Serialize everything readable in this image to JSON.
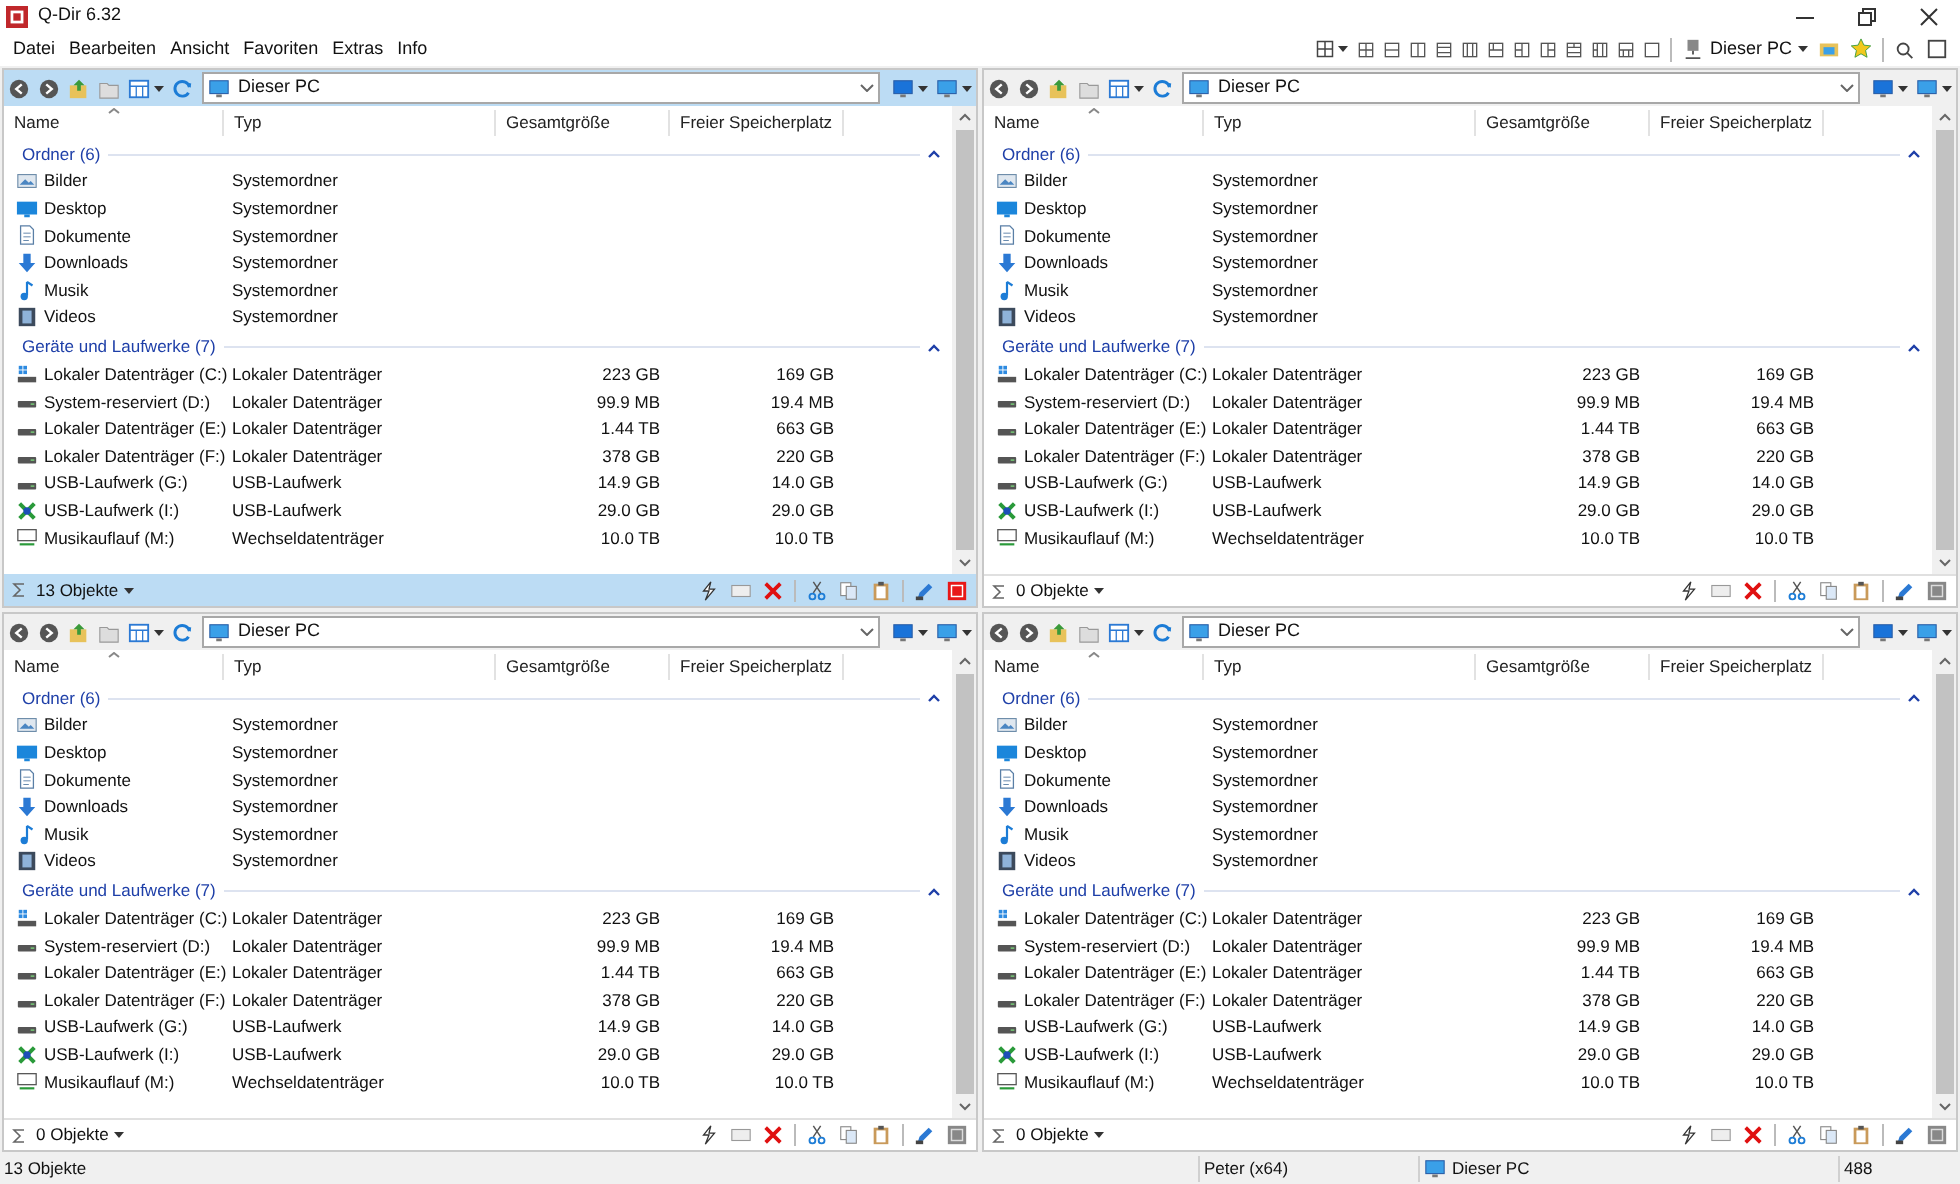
{
  "window": {
    "title": "Q-Dir 6.32"
  },
  "menu": [
    "Datei",
    "Bearbeiten",
    "Ansicht",
    "Favoriten",
    "Extras",
    "Info"
  ],
  "toolbar": {
    "location": "Dieser PC"
  },
  "panes": [
    {
      "active": true,
      "address": "Dieser PC",
      "columns": [
        "Name",
        "Typ",
        "Gesamtgröße",
        "Freier Speicherplatz"
      ],
      "groups": [
        {
          "title": "Ordner (6)",
          "items": [
            {
              "kind": "pictures",
              "name": "Bilder",
              "type": "Systemordner"
            },
            {
              "kind": "desktop",
              "name": "Desktop",
              "type": "Systemordner"
            },
            {
              "kind": "documents",
              "name": "Dokumente",
              "type": "Systemordner"
            },
            {
              "kind": "downloads",
              "name": "Downloads",
              "type": "Systemordner"
            },
            {
              "kind": "music",
              "name": "Musik",
              "type": "Systemordner"
            },
            {
              "kind": "videos",
              "name": "Videos",
              "type": "Systemordner"
            }
          ]
        },
        {
          "title": "Geräte und Laufwerke (7)",
          "items": [
            {
              "kind": "system-drive",
              "name": "Lokaler Datenträger (C:)",
              "type": "Lokaler Datenträger",
              "total": "223 GB",
              "free": "169 GB"
            },
            {
              "kind": "drive",
              "name": "System-reserviert (D:)",
              "type": "Lokaler Datenträger",
              "total": "99.9 MB",
              "free": "19.4 MB"
            },
            {
              "kind": "drive",
              "name": "Lokaler Datenträger (E:)",
              "type": "Lokaler Datenträger",
              "total": "1.44 TB",
              "free": "663 GB"
            },
            {
              "kind": "drive",
              "name": "Lokaler Datenträger (F:)",
              "type": "Lokaler Datenträger",
              "total": "378 GB",
              "free": "220 GB"
            },
            {
              "kind": "drive",
              "name": "USB-Laufwerk (G:)",
              "type": "USB-Laufwerk",
              "total": "14.9 GB",
              "free": "14.0 GB"
            },
            {
              "kind": "usb-special",
              "name": "USB-Laufwerk (I:)",
              "type": "USB-Laufwerk",
              "total": "29.0 GB",
              "free": "29.0 GB"
            },
            {
              "kind": "network",
              "name": "Musikauflauf (M:)",
              "type": "Wechseldatenträger",
              "total": "10.0 TB",
              "free": "10.0 TB"
            }
          ]
        }
      ],
      "status": "13 Objekte"
    },
    {
      "active": false,
      "address": "Dieser PC",
      "columns": [
        "Name",
        "Typ",
        "Gesamtgröße",
        "Freier Speicherplatz"
      ],
      "groups": [
        {
          "title": "Ordner (6)",
          "items": [
            {
              "kind": "pictures",
              "name": "Bilder",
              "type": "Systemordner"
            },
            {
              "kind": "desktop",
              "name": "Desktop",
              "type": "Systemordner"
            },
            {
              "kind": "documents",
              "name": "Dokumente",
              "type": "Systemordner"
            },
            {
              "kind": "downloads",
              "name": "Downloads",
              "type": "Systemordner"
            },
            {
              "kind": "music",
              "name": "Musik",
              "type": "Systemordner"
            },
            {
              "kind": "videos",
              "name": "Videos",
              "type": "Systemordner"
            }
          ]
        },
        {
          "title": "Geräte und Laufwerke (7)",
          "items": [
            {
              "kind": "system-drive",
              "name": "Lokaler Datenträger (C:)",
              "type": "Lokaler Datenträger",
              "total": "223 GB",
              "free": "169 GB"
            },
            {
              "kind": "drive",
              "name": "System-reserviert (D:)",
              "type": "Lokaler Datenträger",
              "total": "99.9 MB",
              "free": "19.4 MB"
            },
            {
              "kind": "drive",
              "name": "Lokaler Datenträger (E:)",
              "type": "Lokaler Datenträger",
              "total": "1.44 TB",
              "free": "663 GB"
            },
            {
              "kind": "drive",
              "name": "Lokaler Datenträger (F:)",
              "type": "Lokaler Datenträger",
              "total": "378 GB",
              "free": "220 GB"
            },
            {
              "kind": "drive",
              "name": "USB-Laufwerk (G:)",
              "type": "USB-Laufwerk",
              "total": "14.9 GB",
              "free": "14.0 GB"
            },
            {
              "kind": "usb-special",
              "name": "USB-Laufwerk (I:)",
              "type": "USB-Laufwerk",
              "total": "29.0 GB",
              "free": "29.0 GB"
            },
            {
              "kind": "network",
              "name": "Musikauflauf (M:)",
              "type": "Wechseldatenträger",
              "total": "10.0 TB",
              "free": "10.0 TB"
            }
          ]
        }
      ],
      "status": "0 Objekte"
    },
    {
      "active": false,
      "address": "Dieser PC",
      "columns": [
        "Name",
        "Typ",
        "Gesamtgröße",
        "Freier Speicherplatz"
      ],
      "groups": [
        {
          "title": "Ordner (6)",
          "items": [
            {
              "kind": "pictures",
              "name": "Bilder",
              "type": "Systemordner"
            },
            {
              "kind": "desktop",
              "name": "Desktop",
              "type": "Systemordner"
            },
            {
              "kind": "documents",
              "name": "Dokumente",
              "type": "Systemordner"
            },
            {
              "kind": "downloads",
              "name": "Downloads",
              "type": "Systemordner"
            },
            {
              "kind": "music",
              "name": "Musik",
              "type": "Systemordner"
            },
            {
              "kind": "videos",
              "name": "Videos",
              "type": "Systemordner"
            }
          ]
        },
        {
          "title": "Geräte und Laufwerke (7)",
          "items": [
            {
              "kind": "system-drive",
              "name": "Lokaler Datenträger (C:)",
              "type": "Lokaler Datenträger",
              "total": "223 GB",
              "free": "169 GB"
            },
            {
              "kind": "drive",
              "name": "System-reserviert (D:)",
              "type": "Lokaler Datenträger",
              "total": "99.9 MB",
              "free": "19.4 MB"
            },
            {
              "kind": "drive",
              "name": "Lokaler Datenträger (E:)",
              "type": "Lokaler Datenträger",
              "total": "1.44 TB",
              "free": "663 GB"
            },
            {
              "kind": "drive",
              "name": "Lokaler Datenträger (F:)",
              "type": "Lokaler Datenträger",
              "total": "378 GB",
              "free": "220 GB"
            },
            {
              "kind": "drive",
              "name": "USB-Laufwerk (G:)",
              "type": "USB-Laufwerk",
              "total": "14.9 GB",
              "free": "14.0 GB"
            },
            {
              "kind": "usb-special",
              "name": "USB-Laufwerk (I:)",
              "type": "USB-Laufwerk",
              "total": "29.0 GB",
              "free": "29.0 GB"
            },
            {
              "kind": "network",
              "name": "Musikauflauf (M:)",
              "type": "Wechseldatenträger",
              "total": "10.0 TB",
              "free": "10.0 TB"
            }
          ]
        }
      ],
      "status": "0 Objekte"
    },
    {
      "active": false,
      "address": "Dieser PC",
      "columns": [
        "Name",
        "Typ",
        "Gesamtgröße",
        "Freier Speicherplatz"
      ],
      "groups": [
        {
          "title": "Ordner (6)",
          "items": [
            {
              "kind": "pictures",
              "name": "Bilder",
              "type": "Systemordner"
            },
            {
              "kind": "desktop",
              "name": "Desktop",
              "type": "Systemordner"
            },
            {
              "kind": "documents",
              "name": "Dokumente",
              "type": "Systemordner"
            },
            {
              "kind": "downloads",
              "name": "Downloads",
              "type": "Systemordner"
            },
            {
              "kind": "music",
              "name": "Musik",
              "type": "Systemordner"
            },
            {
              "kind": "videos",
              "name": "Videos",
              "type": "Systemordner"
            }
          ]
        },
        {
          "title": "Geräte und Laufwerke (7)",
          "items": [
            {
              "kind": "system-drive",
              "name": "Lokaler Datenträger (C:)",
              "type": "Lokaler Datenträger",
              "total": "223 GB",
              "free": "169 GB"
            },
            {
              "kind": "drive",
              "name": "System-reserviert (D:)",
              "type": "Lokaler Datenträger",
              "total": "99.9 MB",
              "free": "19.4 MB"
            },
            {
              "kind": "drive",
              "name": "Lokaler Datenträger (E:)",
              "type": "Lokaler Datenträger",
              "total": "1.44 TB",
              "free": "663 GB"
            },
            {
              "kind": "drive",
              "name": "Lokaler Datenträger (F:)",
              "type": "Lokaler Datenträger",
              "total": "378 GB",
              "free": "220 GB"
            },
            {
              "kind": "drive",
              "name": "USB-Laufwerk (G:)",
              "type": "USB-Laufwerk",
              "total": "14.9 GB",
              "free": "14.0 GB"
            },
            {
              "kind": "usb-special",
              "name": "USB-Laufwerk (I:)",
              "type": "USB-Laufwerk",
              "total": "29.0 GB",
              "free": "29.0 GB"
            },
            {
              "kind": "network",
              "name": "Musikauflauf (M:)",
              "type": "Wechseldatenträger",
              "total": "10.0 TB",
              "free": "10.0 TB"
            }
          ]
        }
      ],
      "status": "0 Objekte"
    }
  ],
  "status_bar": {
    "summary": "13 Objekte",
    "user": "Peter (x64)",
    "location": "Dieser PC",
    "count": "488"
  }
}
